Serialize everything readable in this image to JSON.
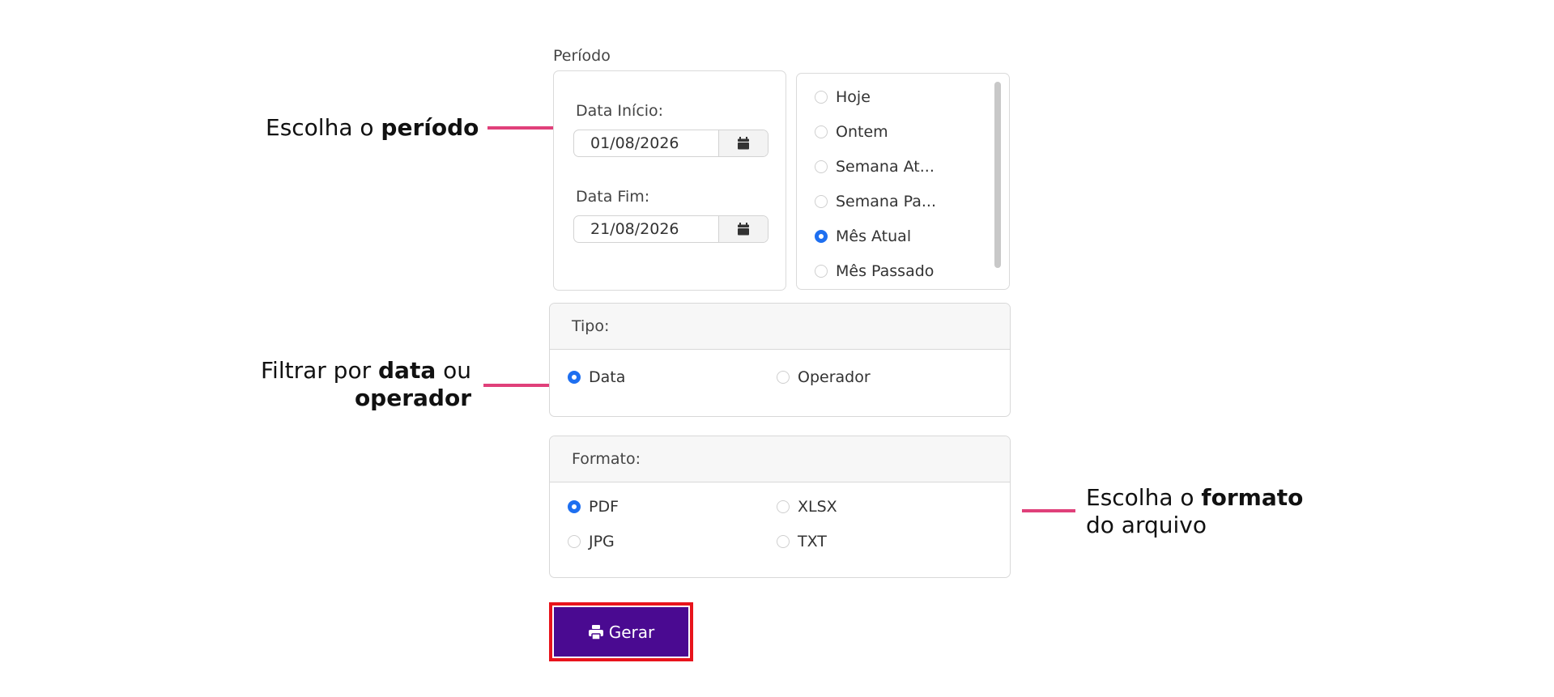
{
  "annotations": {
    "periodo": {
      "prefix": "Escolha o ",
      "bold": "período"
    },
    "tipo": {
      "line1_prefix": "Filtrar por ",
      "line1_bold": "data",
      "line1_suffix": " ou",
      "line2_bold": "operador"
    },
    "formato": {
      "line1_prefix": "Escolha o ",
      "line1_bold": "formato",
      "line2": "do arquivo"
    },
    "connector_color": "#e0407a"
  },
  "periodo": {
    "label": "Período",
    "start_label": "Data Início:",
    "start_value": "01/08/2026",
    "end_label": "Data Fim:",
    "end_value": "21/08/2026",
    "calendar_icon": "calendar-icon",
    "presets": [
      {
        "label": "Hoje",
        "checked": false
      },
      {
        "label": "Ontem",
        "checked": false
      },
      {
        "label": "Semana At...",
        "checked": false
      },
      {
        "label": "Semana Pa...",
        "checked": false
      },
      {
        "label": "Mês Atual",
        "checked": true
      },
      {
        "label": "Mês Passado",
        "checked": false
      }
    ]
  },
  "tipo": {
    "header": "Tipo:",
    "options": [
      {
        "label": "Data",
        "checked": true
      },
      {
        "label": "Operador",
        "checked": false
      }
    ]
  },
  "formato": {
    "header": "Formato:",
    "options": [
      {
        "label": "PDF",
        "checked": true
      },
      {
        "label": "XLSX",
        "checked": false
      },
      {
        "label": "JPG",
        "checked": false
      },
      {
        "label": "TXT",
        "checked": false
      }
    ]
  },
  "action": {
    "label": "Gerar",
    "icon": "printer-icon",
    "button_color": "#4a0a91",
    "highlight_color": "#e8141c"
  },
  "radio_color": "#1e6ff0"
}
